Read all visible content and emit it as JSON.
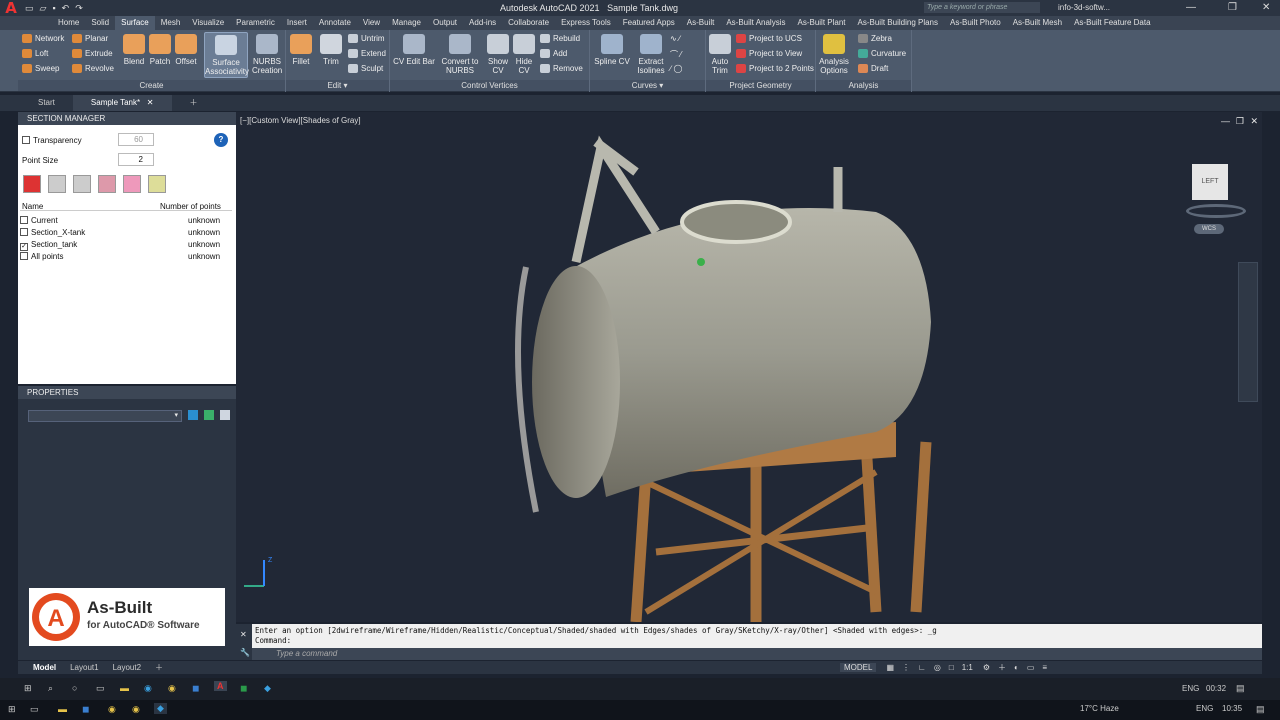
{
  "title_bar": {
    "app_title": "Autodesk AutoCAD 2021",
    "file_title": "Sample Tank.dwg",
    "search_placeholder": "Type a keyword or phrase",
    "user": "info-3d-softw..."
  },
  "ribbon_tabs": [
    "Home",
    "Solid",
    "Surface",
    "Mesh",
    "Visualize",
    "Parametric",
    "Insert",
    "Annotate",
    "View",
    "Manage",
    "Output",
    "Add-ins",
    "Collaborate",
    "Express Tools",
    "Featured Apps",
    "As-Built",
    "As-Built Analysis",
    "As-Built Plant",
    "As-Built Building Plans",
    "As-Built Photo",
    "As-Built Mesh",
    "As-Built Feature Data"
  ],
  "active_ribbon_tab": "Surface",
  "create_panel": {
    "title": "Create",
    "small": [
      "Network",
      "Loft",
      "Sweep",
      "Planar",
      "Extrude",
      "Revolve"
    ],
    "big": [
      "Blend",
      "Patch",
      "Offset",
      "Surface Associativity",
      "NURBS Creation"
    ]
  },
  "edit_panel": {
    "title": "Edit",
    "big": [
      "Fillet",
      "Trim"
    ],
    "small": [
      "Untrim",
      "Extend",
      "Sculpt"
    ]
  },
  "cv_panel": {
    "title": "Control Vertices",
    "big": [
      "CV Edit Bar",
      "Convert to NURBS",
      "Show CV",
      "Hide CV"
    ],
    "small": [
      "Rebuild",
      "Add",
      "Remove"
    ]
  },
  "curves_panel": {
    "title": "Curves",
    "big": [
      "Spline CV",
      "Extract Isolines"
    ]
  },
  "projgeo_panel": {
    "title": "Project Geometry",
    "big": [
      "Auto Trim"
    ],
    "small": [
      "Project to UCS",
      "Project to View",
      "Project to 2 Points"
    ]
  },
  "analysis_panel": {
    "title": "Analysis",
    "big": [
      "Analysis Options"
    ],
    "small": [
      "Zebra",
      "Curvature",
      "Draft"
    ]
  },
  "file_tabs": [
    "Start",
    "Sample Tank*"
  ],
  "section_manager": {
    "title": "SECTION MANAGER",
    "transparency_label": "Transparency",
    "transparency_value": "60",
    "point_size_label": "Point Size",
    "point_size_value": "2",
    "col_name": "Name",
    "col_points": "Number of points",
    "rows": [
      {
        "name": "Current",
        "points": "unknown",
        "checked": false
      },
      {
        "name": "Section_X-tank",
        "points": "unknown",
        "checked": false
      },
      {
        "name": "Section_tank",
        "points": "unknown",
        "checked": true
      },
      {
        "name": "All points",
        "points": "unknown",
        "checked": false
      }
    ]
  },
  "properties": {
    "title": "PROPERTIES"
  },
  "viewport": {
    "label": "[−][Custom View][Shades of Gray]",
    "viewcube_face": "LEFT",
    "wcs_label": "WCS"
  },
  "command": {
    "history": "Enter an option [2dwireframe/Wireframe/Hidden/Realistic/Conceptual/Shaded/shaded with Edges/shades of Gray/SKetchy/X-ray/Other] <Shaded with edges>: _g",
    "history2": "Command:",
    "placeholder": "Type a command"
  },
  "layout_tabs": [
    "Model",
    "Layout1",
    "Layout2"
  ],
  "status": {
    "model": "MODEL",
    "scale": "1:1"
  },
  "branding": {
    "name": "As-Built",
    "sub": "for AutoCAD® Software"
  },
  "taskbar": {
    "lang": "ENG",
    "time1": "00:32",
    "weather": "17°C  Haze",
    "time2": "10:35"
  },
  "colors": {
    "accent": "#e33333",
    "ribbon": "#4d5a6c",
    "viewport": "#212836"
  }
}
